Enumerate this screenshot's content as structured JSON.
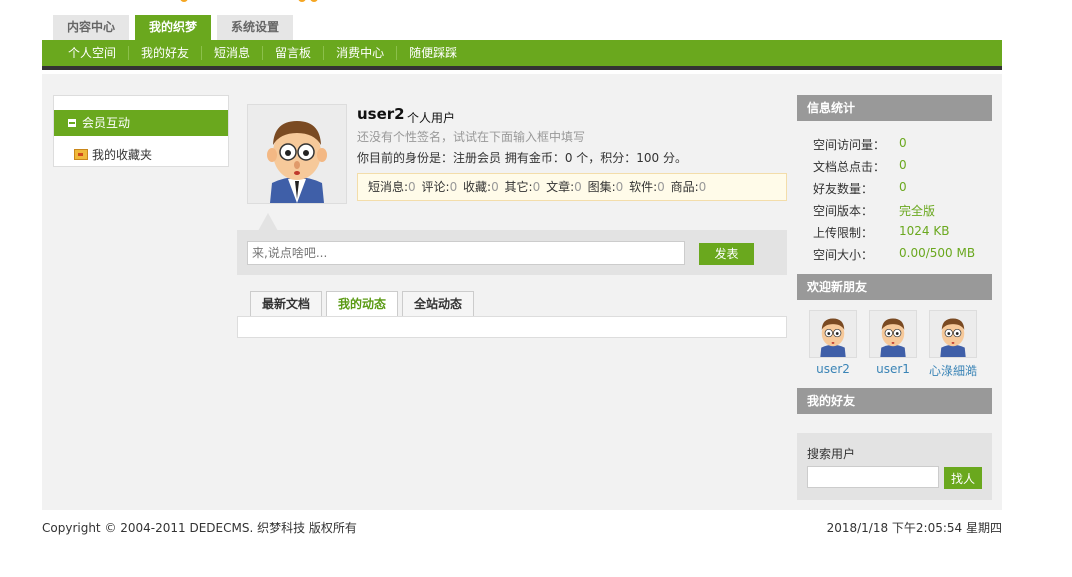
{
  "brand": {
    "accent": "#6aa81e",
    "dark_bar": "#333333",
    "logo_orange": "#f5a623"
  },
  "top_tabs": [
    {
      "label": "内容中心",
      "active": false
    },
    {
      "label": "我的织梦",
      "active": true
    },
    {
      "label": "系统设置",
      "active": false
    }
  ],
  "main_nav": [
    "个人空间",
    "我的好友",
    "短消息",
    "留言板",
    "消费中心",
    "随便踩踩"
  ],
  "left_menu": {
    "section": "会员互动",
    "favorites": "我的收藏夹",
    "folder_icon": "folder-icon"
  },
  "profile": {
    "username": "user2",
    "user_type": "个人用户",
    "signature": "还没有个性签名，试试在下面输入框中填写",
    "identity_text": "你目前的身份是：注册会员 拥有金币：0 个，积分：100 分。",
    "stats": [
      {
        "label": "短消息:",
        "value": "0"
      },
      {
        "label": "评论:",
        "value": "0"
      },
      {
        "label": "收藏:",
        "value": "0"
      },
      {
        "label": "其它:",
        "value": "0"
      },
      {
        "label": "文章:",
        "value": "0"
      },
      {
        "label": "图集:",
        "value": "0"
      },
      {
        "label": "软件:",
        "value": "0"
      },
      {
        "label": "商品:",
        "value": "0"
      }
    ]
  },
  "post": {
    "placeholder": "来,说点啥吧...",
    "submit": "发表"
  },
  "sub_tabs": [
    {
      "label": "最新文档",
      "active": false
    },
    {
      "label": "我的动态",
      "active": true
    },
    {
      "label": "全站动态",
      "active": false
    }
  ],
  "sidebar": {
    "info_title": "信息统计",
    "info": [
      {
        "label": "空间访问量：",
        "value": "0"
      },
      {
        "label": "文档总点击：",
        "value": "0"
      },
      {
        "label": "好友数量：",
        "value": "0"
      },
      {
        "label": "空间版本：",
        "value": "完全版"
      },
      {
        "label": "上传限制：",
        "value": "1024 KB"
      },
      {
        "label": "空间大小：",
        "value": "0.00/500 MB"
      }
    ],
    "new_friends_title": "欢迎新朋友",
    "new_friends": [
      "user2",
      "user1",
      "心淥細澔"
    ],
    "my_friends_title": "我的好友",
    "search": {
      "label": "搜索用户",
      "button": "找人"
    }
  },
  "footer": {
    "copyright": "Copyright © 2004-2011 DEDECMS. 织梦科技 版权所有",
    "datetime": "2018/1/18 下午2:05:54 星期四"
  }
}
